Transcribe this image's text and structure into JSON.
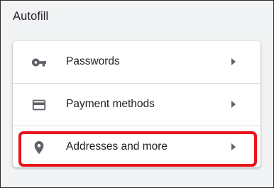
{
  "section": {
    "title": "Autofill"
  },
  "items": [
    {
      "label": "Passwords",
      "icon": "key-icon",
      "arrow": "chevron-right-icon"
    },
    {
      "label": "Payment methods",
      "icon": "credit-card-icon",
      "arrow": "chevron-right-icon"
    },
    {
      "label": "Addresses and more",
      "icon": "location-pin-icon",
      "arrow": "chevron-right-icon",
      "highlighted": true
    }
  ],
  "colors": {
    "background": "#f1f3f4",
    "card": "#ffffff",
    "text": "#202124",
    "icon": "#5f6368",
    "divider": "#dadce0",
    "highlight": "#e8141a"
  }
}
